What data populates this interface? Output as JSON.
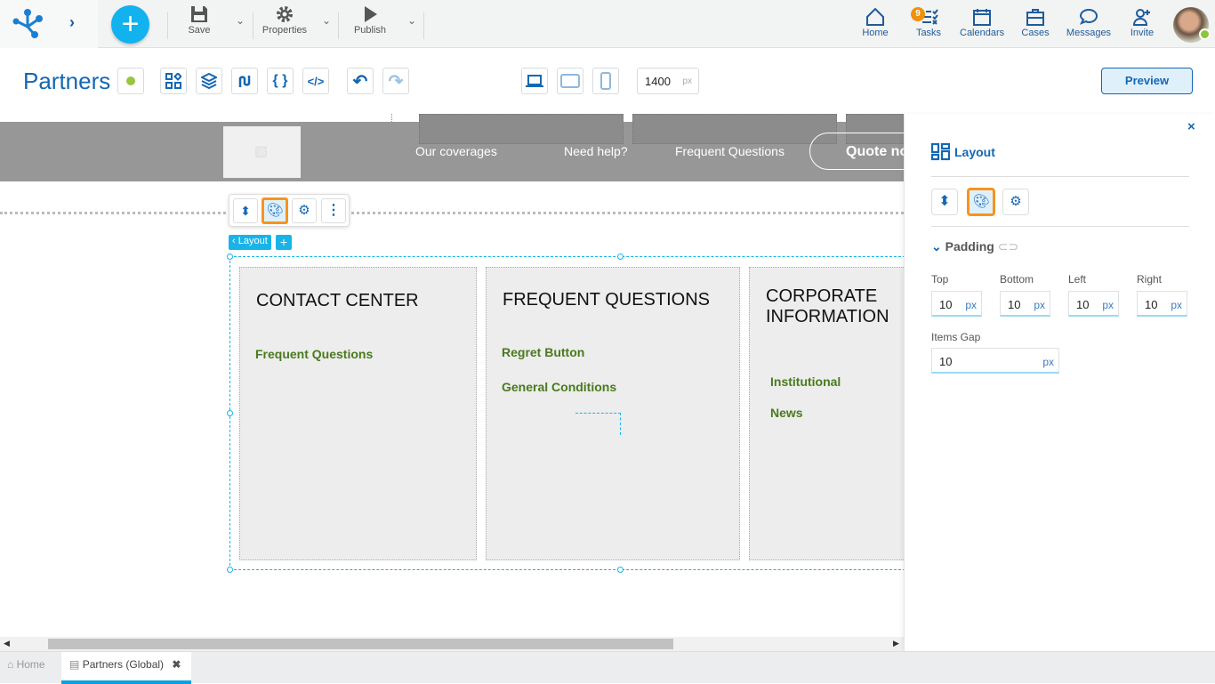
{
  "toolbar": {
    "save": "Save",
    "properties": "Properties",
    "publish": "Publish"
  },
  "nav": [
    {
      "label": "Home",
      "icon": "home-icon"
    },
    {
      "label": "Tasks",
      "icon": "tasks-icon",
      "badge": "9"
    },
    {
      "label": "Calendars",
      "icon": "calendar-icon"
    },
    {
      "label": "Cases",
      "icon": "briefcase-icon"
    },
    {
      "label": "Messages",
      "icon": "message-icon"
    },
    {
      "label": "Invite",
      "icon": "invite-icon"
    }
  ],
  "page": {
    "title": "Partners",
    "status_color": "#9bc53d",
    "width_value": "1400",
    "width_unit": "px",
    "preview": "Preview"
  },
  "site_header": {
    "menu": [
      "Our coverages",
      "Need help?",
      "Frequent Questions"
    ],
    "cta": "Quote no"
  },
  "selection": {
    "label": "Layout",
    "add": "+"
  },
  "cards": [
    {
      "title": "CONTACT CENTER",
      "links": [
        "Frequent Questions"
      ]
    },
    {
      "title": "FREQUENT QUESTIONS",
      "links": [
        "Regret Button",
        "General Conditions"
      ]
    },
    {
      "title": "CORPORATE INFORMATION",
      "links": [
        "Institutional",
        "News"
      ]
    }
  ],
  "panel": {
    "title": "Layout",
    "section": "Padding",
    "fields": [
      {
        "label": "Top",
        "value": "10",
        "unit": "px"
      },
      {
        "label": "Bottom",
        "value": "10",
        "unit": "px"
      },
      {
        "label": "Left",
        "value": "10",
        "unit": "px"
      },
      {
        "label": "Right",
        "value": "10",
        "unit": "px"
      }
    ],
    "gap": {
      "label": "Items Gap",
      "value": "10",
      "unit": "px"
    }
  },
  "tabs": [
    {
      "label": "Home"
    },
    {
      "label": "Partners (Global)",
      "active": true
    }
  ],
  "colors": {
    "accent": "#0a63b0",
    "highlight": "#f7941d",
    "selection": "#18b4e9"
  }
}
